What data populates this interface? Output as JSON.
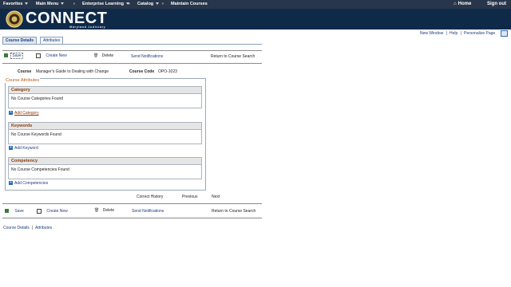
{
  "topnav": {
    "favorites": "Favorites",
    "main_menu": "Main Menu",
    "enterprise_learning": "Enterprise Learning",
    "catalog": "Catalog",
    "maintain_courses": "Maintain Courses",
    "home": "Home",
    "sign_out": "Sign out"
  },
  "brand": {
    "name": "CONNECT",
    "subtitle": "Maryland Judiciary"
  },
  "page_util": {
    "new_window": "New Window",
    "help": "Help",
    "personalize": "Personalize Page"
  },
  "tabs": [
    {
      "label": "Course Details"
    },
    {
      "label": "Attributes"
    }
  ],
  "toolbar": {
    "save": "Save",
    "create_new": "Create New",
    "delete": "Delete",
    "send_notifications": "Send Notifications",
    "return": "Return to Course Search"
  },
  "course": {
    "course_label": "Course",
    "course_name": "Manager's Guide to Dealing with Change",
    "code_label": "Course Code",
    "code_value": "OPO-1023"
  },
  "attributes": {
    "title": "Course Attributes",
    "category": {
      "title": "Category",
      "empty": "No Course Categories Found",
      "add": "Add Category"
    },
    "keywords": {
      "title": "Keywords",
      "empty": "No Course Keywords Found",
      "add": "Add Keyword"
    },
    "competency": {
      "title": "Competency",
      "empty": "No Course Competencies Found",
      "add": "Add Competencies"
    }
  },
  "pager": {
    "correct_history": "Correct History",
    "previous": "Previous",
    "next": "Next"
  },
  "footer_links": {
    "course_details": "Course Details",
    "sep": "|",
    "attributes": "Attributes"
  },
  "colors": {
    "nav_bg": "#27364a",
    "banner_bg": "#0f2a49",
    "section_title": "#8a3d0c",
    "link": "#1d3d7a"
  }
}
